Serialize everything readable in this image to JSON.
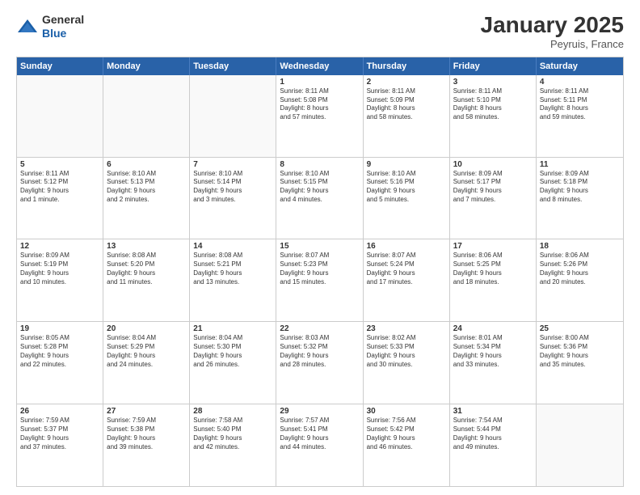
{
  "logo": {
    "general": "General",
    "blue": "Blue"
  },
  "header": {
    "month": "January 2025",
    "location": "Peyruis, France"
  },
  "days": [
    "Sunday",
    "Monday",
    "Tuesday",
    "Wednesday",
    "Thursday",
    "Friday",
    "Saturday"
  ],
  "rows": [
    [
      {
        "day": "",
        "empty": true
      },
      {
        "day": "",
        "empty": true
      },
      {
        "day": "",
        "empty": true
      },
      {
        "day": "1",
        "line1": "Sunrise: 8:11 AM",
        "line2": "Sunset: 5:08 PM",
        "line3": "Daylight: 8 hours",
        "line4": "and 57 minutes."
      },
      {
        "day": "2",
        "line1": "Sunrise: 8:11 AM",
        "line2": "Sunset: 5:09 PM",
        "line3": "Daylight: 8 hours",
        "line4": "and 58 minutes."
      },
      {
        "day": "3",
        "line1": "Sunrise: 8:11 AM",
        "line2": "Sunset: 5:10 PM",
        "line3": "Daylight: 8 hours",
        "line4": "and 58 minutes."
      },
      {
        "day": "4",
        "line1": "Sunrise: 8:11 AM",
        "line2": "Sunset: 5:11 PM",
        "line3": "Daylight: 8 hours",
        "line4": "and 59 minutes."
      }
    ],
    [
      {
        "day": "5",
        "line1": "Sunrise: 8:11 AM",
        "line2": "Sunset: 5:12 PM",
        "line3": "Daylight: 9 hours",
        "line4": "and 1 minute."
      },
      {
        "day": "6",
        "line1": "Sunrise: 8:10 AM",
        "line2": "Sunset: 5:13 PM",
        "line3": "Daylight: 9 hours",
        "line4": "and 2 minutes."
      },
      {
        "day": "7",
        "line1": "Sunrise: 8:10 AM",
        "line2": "Sunset: 5:14 PM",
        "line3": "Daylight: 9 hours",
        "line4": "and 3 minutes."
      },
      {
        "day": "8",
        "line1": "Sunrise: 8:10 AM",
        "line2": "Sunset: 5:15 PM",
        "line3": "Daylight: 9 hours",
        "line4": "and 4 minutes."
      },
      {
        "day": "9",
        "line1": "Sunrise: 8:10 AM",
        "line2": "Sunset: 5:16 PM",
        "line3": "Daylight: 9 hours",
        "line4": "and 5 minutes."
      },
      {
        "day": "10",
        "line1": "Sunrise: 8:09 AM",
        "line2": "Sunset: 5:17 PM",
        "line3": "Daylight: 9 hours",
        "line4": "and 7 minutes."
      },
      {
        "day": "11",
        "line1": "Sunrise: 8:09 AM",
        "line2": "Sunset: 5:18 PM",
        "line3": "Daylight: 9 hours",
        "line4": "and 8 minutes."
      }
    ],
    [
      {
        "day": "12",
        "line1": "Sunrise: 8:09 AM",
        "line2": "Sunset: 5:19 PM",
        "line3": "Daylight: 9 hours",
        "line4": "and 10 minutes."
      },
      {
        "day": "13",
        "line1": "Sunrise: 8:08 AM",
        "line2": "Sunset: 5:20 PM",
        "line3": "Daylight: 9 hours",
        "line4": "and 11 minutes."
      },
      {
        "day": "14",
        "line1": "Sunrise: 8:08 AM",
        "line2": "Sunset: 5:21 PM",
        "line3": "Daylight: 9 hours",
        "line4": "and 13 minutes."
      },
      {
        "day": "15",
        "line1": "Sunrise: 8:07 AM",
        "line2": "Sunset: 5:23 PM",
        "line3": "Daylight: 9 hours",
        "line4": "and 15 minutes."
      },
      {
        "day": "16",
        "line1": "Sunrise: 8:07 AM",
        "line2": "Sunset: 5:24 PM",
        "line3": "Daylight: 9 hours",
        "line4": "and 17 minutes."
      },
      {
        "day": "17",
        "line1": "Sunrise: 8:06 AM",
        "line2": "Sunset: 5:25 PM",
        "line3": "Daylight: 9 hours",
        "line4": "and 18 minutes."
      },
      {
        "day": "18",
        "line1": "Sunrise: 8:06 AM",
        "line2": "Sunset: 5:26 PM",
        "line3": "Daylight: 9 hours",
        "line4": "and 20 minutes."
      }
    ],
    [
      {
        "day": "19",
        "line1": "Sunrise: 8:05 AM",
        "line2": "Sunset: 5:28 PM",
        "line3": "Daylight: 9 hours",
        "line4": "and 22 minutes."
      },
      {
        "day": "20",
        "line1": "Sunrise: 8:04 AM",
        "line2": "Sunset: 5:29 PM",
        "line3": "Daylight: 9 hours",
        "line4": "and 24 minutes."
      },
      {
        "day": "21",
        "line1": "Sunrise: 8:04 AM",
        "line2": "Sunset: 5:30 PM",
        "line3": "Daylight: 9 hours",
        "line4": "and 26 minutes."
      },
      {
        "day": "22",
        "line1": "Sunrise: 8:03 AM",
        "line2": "Sunset: 5:32 PM",
        "line3": "Daylight: 9 hours",
        "line4": "and 28 minutes."
      },
      {
        "day": "23",
        "line1": "Sunrise: 8:02 AM",
        "line2": "Sunset: 5:33 PM",
        "line3": "Daylight: 9 hours",
        "line4": "and 30 minutes."
      },
      {
        "day": "24",
        "line1": "Sunrise: 8:01 AM",
        "line2": "Sunset: 5:34 PM",
        "line3": "Daylight: 9 hours",
        "line4": "and 33 minutes."
      },
      {
        "day": "25",
        "line1": "Sunrise: 8:00 AM",
        "line2": "Sunset: 5:36 PM",
        "line3": "Daylight: 9 hours",
        "line4": "and 35 minutes."
      }
    ],
    [
      {
        "day": "26",
        "line1": "Sunrise: 7:59 AM",
        "line2": "Sunset: 5:37 PM",
        "line3": "Daylight: 9 hours",
        "line4": "and 37 minutes."
      },
      {
        "day": "27",
        "line1": "Sunrise: 7:59 AM",
        "line2": "Sunset: 5:38 PM",
        "line3": "Daylight: 9 hours",
        "line4": "and 39 minutes."
      },
      {
        "day": "28",
        "line1": "Sunrise: 7:58 AM",
        "line2": "Sunset: 5:40 PM",
        "line3": "Daylight: 9 hours",
        "line4": "and 42 minutes."
      },
      {
        "day": "29",
        "line1": "Sunrise: 7:57 AM",
        "line2": "Sunset: 5:41 PM",
        "line3": "Daylight: 9 hours",
        "line4": "and 44 minutes."
      },
      {
        "day": "30",
        "line1": "Sunrise: 7:56 AM",
        "line2": "Sunset: 5:42 PM",
        "line3": "Daylight: 9 hours",
        "line4": "and 46 minutes."
      },
      {
        "day": "31",
        "line1": "Sunrise: 7:54 AM",
        "line2": "Sunset: 5:44 PM",
        "line3": "Daylight: 9 hours",
        "line4": "and 49 minutes."
      },
      {
        "day": "",
        "empty": true
      }
    ]
  ]
}
